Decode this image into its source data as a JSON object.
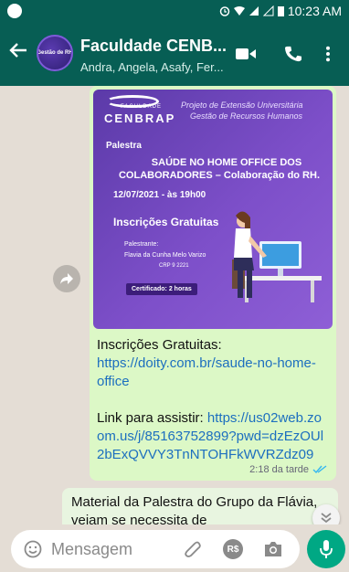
{
  "status_bar": {
    "time": "10:23 AM"
  },
  "header": {
    "avatar_text": "Gestão de RH",
    "title": "Faculdade CENB...",
    "subtitle": "Andra, Angela, Asafy, Fer..."
  },
  "flyer": {
    "logo_small": "FACULDADE",
    "logo": "CENBRAP",
    "project_line1": "Projeto de Extensão Universitária",
    "project_line2": "Gestão de Recursos Humanos",
    "tag": "Palestra",
    "title_line1": "SAÚDE NO HOME OFFICE DOS",
    "title_line2": "COLABORADORES – Colaboração do RH.",
    "date": "12/07/2021 - às 19h00",
    "registration": "Inscrições Gratuitas",
    "speaker_label": "Palestrante:",
    "speaker_name": "Flavia da Cunha Melo Varizo",
    "crp": "CRP 9  2221",
    "certificate": "Certificado: 2 horas"
  },
  "message_out": {
    "line1_label": "Inscrições Gratuitas: ",
    "line1_link": "https://doity.com.br/saude-no-home-office",
    "line2_label": "Link para assistir: ",
    "line2_link": "https://us02web.zoom.us/j/85163752899?pwd=dzEzOUl2bExQVVY3TnNTOHFkWVRZdz09",
    "time": "2:18 da tarde"
  },
  "message_in": {
    "text": "Material da Palestra do Grupo da Flávia, vejam se necessita de"
  },
  "input": {
    "placeholder": "Mensagem",
    "pay_label": "R$"
  },
  "colors": {
    "header": "#075e54",
    "outgoing_bubble": "#dcf8c6",
    "accent": "#00a884",
    "link": "#1d6fbf"
  }
}
